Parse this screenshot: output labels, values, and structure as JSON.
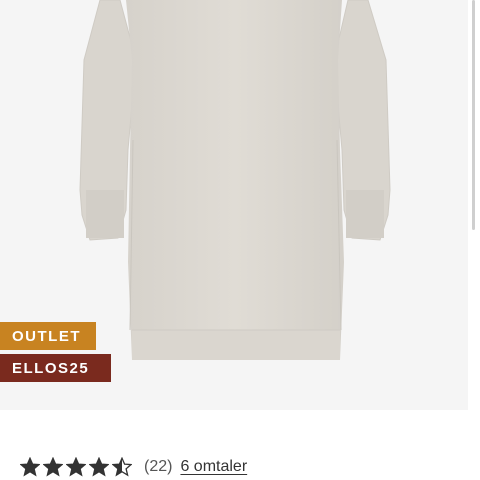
{
  "badges": {
    "outlet": {
      "label": "OUTLET",
      "color": "#c88321"
    },
    "code": {
      "label": "ELLOS25",
      "color": "#7a2a1e"
    }
  },
  "product": {
    "image_icon": "knit-sweater-dress-photo",
    "garment_color": "#dcd8d2"
  },
  "rating": {
    "value": 4.5,
    "max": 5,
    "star_color": "#333333",
    "count_text": "(22)",
    "reviews_link": "6 omtaler"
  }
}
